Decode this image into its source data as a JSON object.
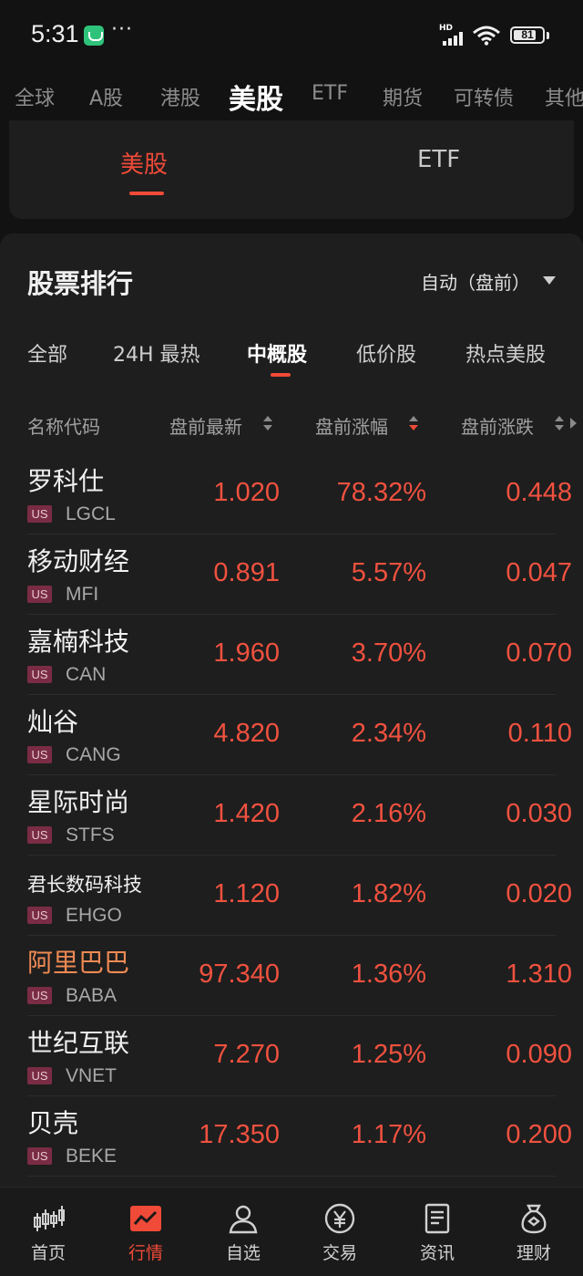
{
  "status": {
    "time": "5:31",
    "dots": "···",
    "network": "HD",
    "battery": "81",
    "battery_level": 0.81
  },
  "market_tabs": [
    {
      "label": "全球",
      "active": false
    },
    {
      "label": "A股",
      "active": false
    },
    {
      "label": "港股",
      "active": false
    },
    {
      "label": "美股",
      "active": true
    },
    {
      "label": "ETF",
      "active": false
    },
    {
      "label": "期货",
      "active": false
    },
    {
      "label": "可转债",
      "active": false
    },
    {
      "label": "其他",
      "active": false
    }
  ],
  "sub_tabs": [
    {
      "label": "美股",
      "active": true
    },
    {
      "label": "ETF",
      "active": false
    }
  ],
  "ranking": {
    "title": "股票排行",
    "mode": "自动（盘前）",
    "filters": [
      {
        "label": "全部",
        "active": false
      },
      {
        "label": "24H 最热",
        "active": false
      },
      {
        "label": "中概股",
        "active": true
      },
      {
        "label": "低价股",
        "active": false
      },
      {
        "label": "热点美股",
        "active": false
      }
    ],
    "columns": {
      "name": "名称代码",
      "price": "盘前最新",
      "pct": "盘前涨幅",
      "chg": "盘前涨跌"
    },
    "badge": "US",
    "rows": [
      {
        "name": "罗科仕",
        "code": "LGCL",
        "price": "1.020",
        "pct": "78.32%",
        "chg": "0.448"
      },
      {
        "name": "移动财经",
        "code": "MFI",
        "price": "0.891",
        "pct": "5.57%",
        "chg": "0.047"
      },
      {
        "name": "嘉楠科技",
        "code": "CAN",
        "price": "1.960",
        "pct": "3.70%",
        "chg": "0.070"
      },
      {
        "name": "灿谷",
        "code": "CANG",
        "price": "4.820",
        "pct": "2.34%",
        "chg": "0.110"
      },
      {
        "name": "星际时尚",
        "code": "STFS",
        "price": "1.420",
        "pct": "2.16%",
        "chg": "0.030"
      },
      {
        "name": "君长数码科技",
        "code": "EHGO",
        "price": "1.120",
        "pct": "1.82%",
        "chg": "0.020"
      },
      {
        "name": "阿里巴巴",
        "code": "BABA",
        "price": "97.340",
        "pct": "1.36%",
        "chg": "1.310"
      },
      {
        "name": "世纪互联",
        "code": "VNET",
        "price": "7.270",
        "pct": "1.25%",
        "chg": "0.090"
      },
      {
        "name": "贝壳",
        "code": "BEKE",
        "price": "17.350",
        "pct": "1.17%",
        "chg": "0.200"
      }
    ]
  },
  "bottom_nav": [
    {
      "label": "首页",
      "icon": "candlestick-icon",
      "active": false
    },
    {
      "label": "行情",
      "icon": "market-chart-icon",
      "active": true
    },
    {
      "label": "自选",
      "icon": "user-watchlist-icon",
      "active": false
    },
    {
      "label": "交易",
      "icon": "yen-coin-icon",
      "active": false
    },
    {
      "label": "资讯",
      "icon": "news-document-icon",
      "active": false
    },
    {
      "label": "理财",
      "icon": "money-bag-icon",
      "active": false
    }
  ],
  "colors": {
    "accent": "#f04a38",
    "highlight_name": "#ef8a54",
    "background": "#121212",
    "card": "#1e1e1e"
  }
}
